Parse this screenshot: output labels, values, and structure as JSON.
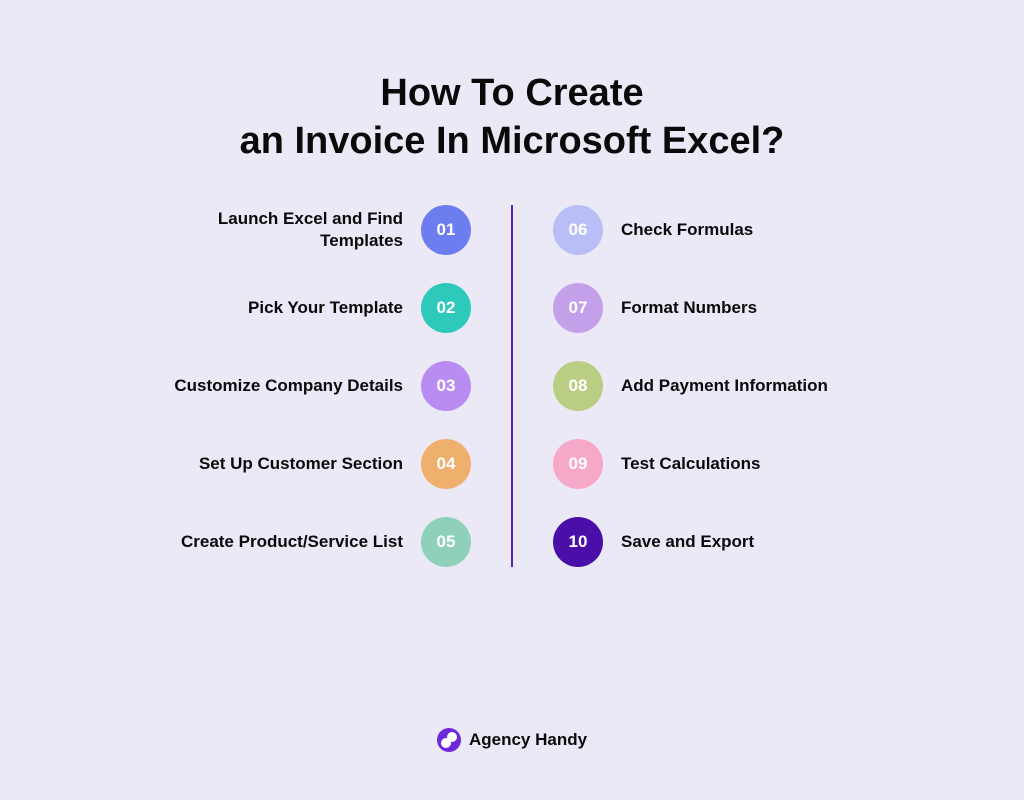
{
  "title_line1": "How To Create",
  "title_line2": "an Invoice In Microsoft Excel?",
  "left_steps": [
    {
      "num": "01",
      "label": "Launch Excel and Find Templates",
      "color": "#6c7df0"
    },
    {
      "num": "02",
      "label": "Pick Your Template",
      "color": "#2fc9bb"
    },
    {
      "num": "03",
      "label": "Customize Company Details",
      "color": "#b98cf2"
    },
    {
      "num": "04",
      "label": "Set Up Customer Section",
      "color": "#efb06e"
    },
    {
      "num": "05",
      "label": "Create Product/Service List",
      "color": "#8fd0bb"
    }
  ],
  "right_steps": [
    {
      "num": "06",
      "label": "Check Formulas",
      "color": "#b9bff6"
    },
    {
      "num": "07",
      "label": "Format Numbers",
      "color": "#c3a0e9"
    },
    {
      "num": "08",
      "label": "Add Payment Information",
      "color": "#b9ce83"
    },
    {
      "num": "09",
      "label": "Test Calculations",
      "color": "#f6a8c9"
    },
    {
      "num": "10",
      "label": "Save and Export",
      "color": "#4a0fa8"
    }
  ],
  "footer_brand": "Agency Handy"
}
